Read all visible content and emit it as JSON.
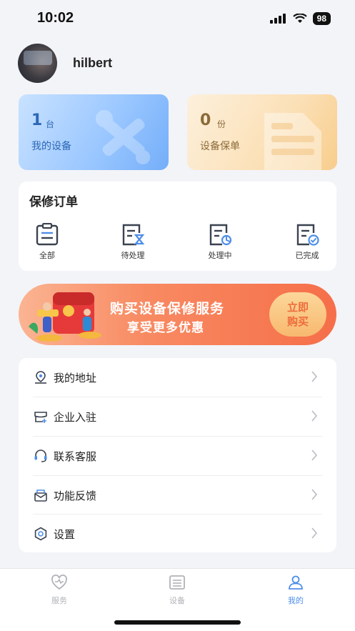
{
  "status_bar": {
    "time": "10:02",
    "battery": "98"
  },
  "profile": {
    "username": "hilbert"
  },
  "stats": [
    {
      "number": "1",
      "unit": "台",
      "label": "我的设备"
    },
    {
      "number": "0",
      "unit": "份",
      "label": "设备保单"
    }
  ],
  "orders": {
    "title": "保修订单",
    "items": [
      {
        "label": "全部",
        "icon": "clipboard-list-icon"
      },
      {
        "label": "待处理",
        "icon": "pending-hourglass-icon"
      },
      {
        "label": "处理中",
        "icon": "processing-icon"
      },
      {
        "label": "已完成",
        "icon": "completed-check-icon"
      }
    ]
  },
  "promo": {
    "line1": "购买设备保修服务",
    "line2": "享受更多优惠",
    "button_line1": "立即",
    "button_line2": "购买"
  },
  "menu": [
    {
      "label": "我的地址",
      "icon": "address-icon"
    },
    {
      "label": "企业入驻",
      "icon": "enterprise-icon"
    },
    {
      "label": "联系客服",
      "icon": "headset-icon"
    },
    {
      "label": "功能反馈",
      "icon": "feedback-mail-icon"
    },
    {
      "label": "设置",
      "icon": "settings-gear-icon"
    }
  ],
  "tabbar": [
    {
      "label": "服务",
      "icon": "service-heart-icon",
      "active": false
    },
    {
      "label": "设备",
      "icon": "device-list-icon",
      "active": false
    },
    {
      "label": "我的",
      "icon": "user-profile-icon",
      "active": true
    }
  ],
  "colors": {
    "accent": "#4d8ee9",
    "promo": "#f56f49",
    "background": "#f3f4f8"
  }
}
